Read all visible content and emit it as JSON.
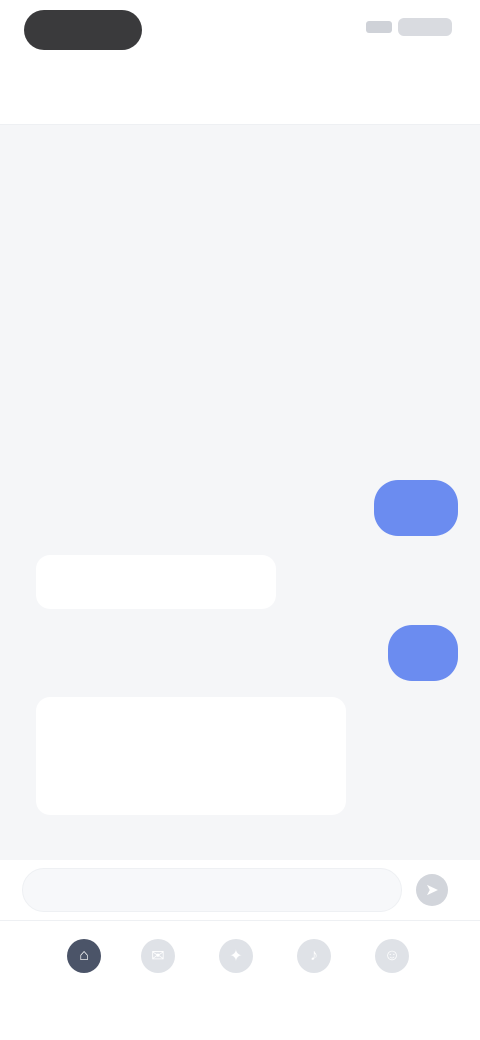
{
  "status_bar": {
    "battery_icon": "battery-icon",
    "signal_icon": "signal-icon"
  },
  "header": {
    "title": ""
  },
  "messages": [
    {
      "role": "user",
      "text": ""
    },
    {
      "role": "assistant",
      "text": ""
    },
    {
      "role": "user",
      "text": ""
    },
    {
      "role": "assistant",
      "text": ""
    }
  ],
  "composer": {
    "placeholder": "",
    "send_icon": "send-icon"
  },
  "bottom_nav": {
    "items": [
      {
        "icon": "home-icon",
        "label": ""
      },
      {
        "icon": "chat-icon",
        "label": ""
      },
      {
        "icon": "explore-icon",
        "label": ""
      },
      {
        "icon": "bell-icon",
        "label": ""
      },
      {
        "icon": "profile-icon",
        "label": ""
      }
    ]
  },
  "colors": {
    "accent": "#6b8cf0",
    "background": "#f5f6f8",
    "surface": "#ffffff"
  }
}
